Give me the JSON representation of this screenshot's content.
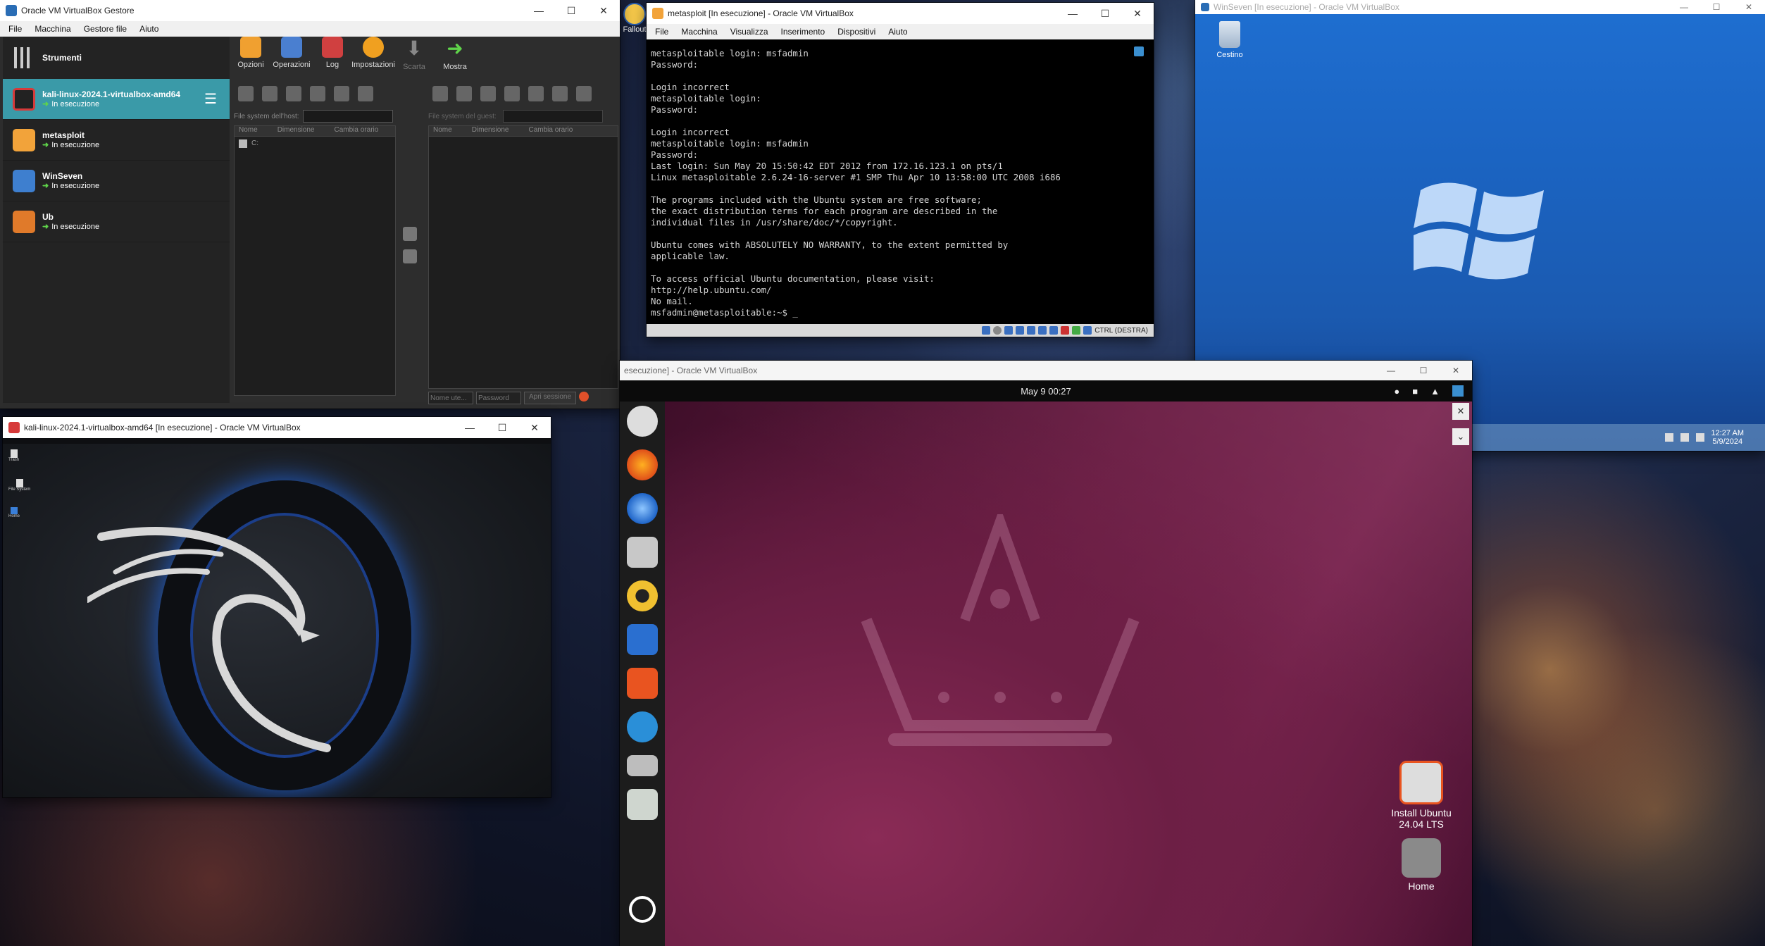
{
  "manager": {
    "title": "Oracle VM VirtualBox Gestore",
    "menu": [
      "File",
      "Macchina",
      "Gestore file",
      "Aiuto"
    ],
    "tools_label": "Strumenti",
    "toolbar": [
      {
        "label": "Opzioni",
        "icon": "options-icon",
        "enabled": true
      },
      {
        "label": "Operazioni",
        "icon": "operations-icon",
        "enabled": true
      },
      {
        "label": "Log",
        "icon": "log-icon",
        "enabled": true
      },
      {
        "label": "Impostazioni",
        "icon": "settings-gear-icon",
        "enabled": true
      },
      {
        "label": "Scarta",
        "icon": "discard-arrow-icon",
        "enabled": false
      },
      {
        "label": "Mostra",
        "icon": "show-arrow-icon",
        "enabled": true
      }
    ],
    "vms": [
      {
        "name": "kali-linux-2024.1-virtualbox-amd64",
        "status": "In esecuzione",
        "selected": true,
        "icon": "kali-icon"
      },
      {
        "name": "metasploit",
        "status": "In esecuzione",
        "selected": false,
        "icon": "linux-26-icon"
      },
      {
        "name": "WinSeven",
        "status": "In esecuzione",
        "selected": false,
        "icon": "windows7-icon"
      },
      {
        "name": "Ub",
        "status": "In esecuzione",
        "selected": false,
        "icon": "ubuntu-icon"
      }
    ],
    "host_fs_label": "File system dell'host:",
    "guest_fs_label": "File system del guest:",
    "columns": [
      "Nome",
      "Dimensione",
      "Cambia orario"
    ],
    "host_drive": "C:",
    "user_placeholder": "Nome ute...",
    "password_placeholder": "Password",
    "open_session": "Apri sessione"
  },
  "metasploit": {
    "title": "metasploit [In esecuzione] - Oracle VM VirtualBox",
    "menu": [
      "File",
      "Macchina",
      "Visualizza",
      "Inserimento",
      "Dispositivi",
      "Aiuto"
    ],
    "terminal_lines": [
      "metasploitable login: msfadmin",
      "Password:",
      "",
      "Login incorrect",
      "metasploitable login:",
      "Password:",
      "",
      "Login incorrect",
      "metasploitable login: msfadmin",
      "Password:",
      "Last login: Sun May 20 15:50:42 EDT 2012 from 172.16.123.1 on pts/1",
      "Linux metasploitable 2.6.24-16-server #1 SMP Thu Apr 10 13:58:00 UTC 2008 i686",
      "",
      "The programs included with the Ubuntu system are free software;",
      "the exact distribution terms for each program are described in the",
      "individual files in /usr/share/doc/*/copyright.",
      "",
      "Ubuntu comes with ABSOLUTELY NO WARRANTY, to the extent permitted by",
      "applicable law.",
      "",
      "To access official Ubuntu documentation, please visit:",
      "http://help.ubuntu.com/",
      "No mail.",
      "msfadmin@metasploitable:~$ _"
    ],
    "host_key": "CTRL (DESTRA)"
  },
  "winseven": {
    "title": "WinSeven [In esecuzione] - Oracle VM VirtualBox",
    "recycle_bin": "Cestino",
    "clock_time": "12:27 AM",
    "clock_date": "5/9/2024"
  },
  "kali": {
    "title": "kali-linux-2024.1-virtualbox-amd64 [In esecuzione] - Oracle VM VirtualBox",
    "desk_icons": [
      "Trash",
      "File System",
      "Home"
    ]
  },
  "ubuntu": {
    "title": "esecuzione] - Oracle VM VirtualBox",
    "topbar_date": "May 9  00:27",
    "install_label": "Install Ubuntu 24.04 LTS",
    "home_label": "Home"
  },
  "desktop": {
    "partial_icon_label": "Fallout"
  },
  "colors": {
    "selection": "#3a9aa8",
    "running": "#5fd44a",
    "ubuntu_accent": "#e95420",
    "win7_blue": "#1f6fd1"
  }
}
